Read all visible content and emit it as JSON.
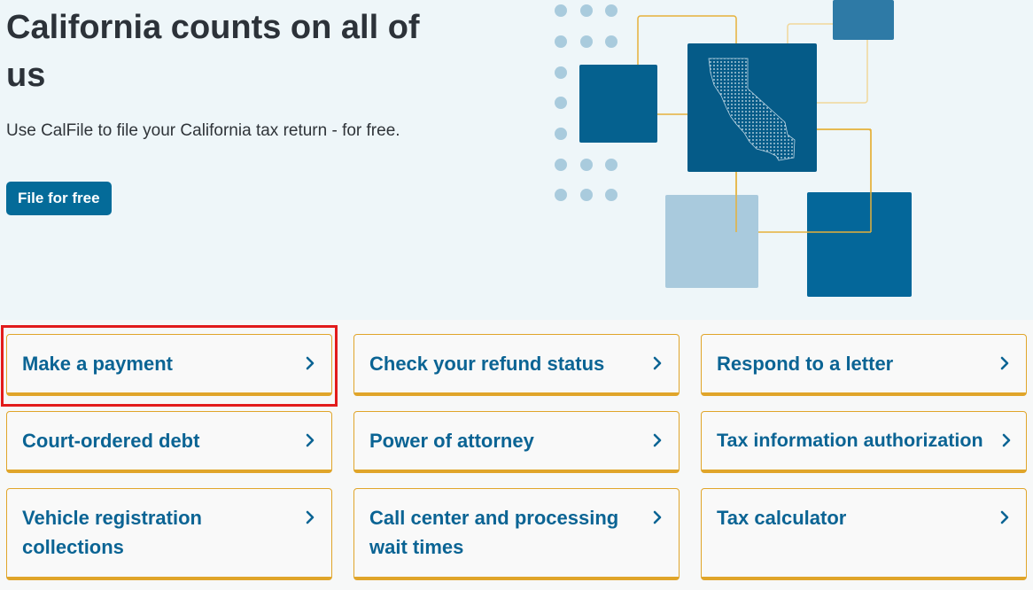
{
  "hero": {
    "title": "California counts on all of us",
    "subtitle": "Use CalFile to file your California tax return - for free.",
    "button_label": "File for free"
  },
  "colors": {
    "hero_bg": "#eef6f9",
    "primary_blue": "#046b99",
    "card_text": "#0b6494",
    "accent_gold": "#e0a52a",
    "highlight_red": "#e21b1b"
  },
  "cards": [
    {
      "label": "Make a payment",
      "icon": "chevron-right-icon"
    },
    {
      "label": "Check your refund status",
      "icon": "chevron-right-icon"
    },
    {
      "label": "Respond to a letter",
      "icon": "chevron-right-icon"
    },
    {
      "label": "Court-ordered debt",
      "icon": "chevron-right-icon"
    },
    {
      "label": "Power of attorney",
      "icon": "chevron-right-icon"
    },
    {
      "label": "Tax information authorization",
      "icon": "chevron-right-icon"
    },
    {
      "label": "Vehicle registration collections",
      "icon": "chevron-right-icon"
    },
    {
      "label": "Call center and processing wait times",
      "icon": "chevron-right-icon"
    },
    {
      "label": "Tax calculator",
      "icon": "chevron-right-icon"
    }
  ],
  "illustration": {
    "icon": "california-map-icon"
  }
}
